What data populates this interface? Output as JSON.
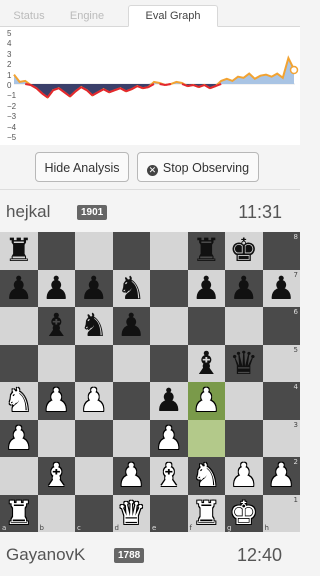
{
  "tabs": [
    {
      "label": "Status"
    },
    {
      "label": "Engine"
    },
    {
      "label": "Eval Graph"
    }
  ],
  "graph": {
    "y_ticks": [
      "5",
      "4",
      "3",
      "2",
      "1",
      "0",
      "−1",
      "−2",
      "−3",
      "−4",
      "−5"
    ],
    "colors": {
      "line": "#f2a332",
      "negative_line": "#e3262f",
      "fill": "#3a3f6a",
      "fill_positive": "#a9c4e4"
    }
  },
  "buttons": {
    "hide_analysis": "Hide Analysis",
    "stop_observing": "Stop Observing"
  },
  "top_player": {
    "name": "hejkal",
    "rating": "1901",
    "clock": "11:31"
  },
  "bottom_player": {
    "name": "GayanovK",
    "rating": "1788",
    "clock": "12:40"
  },
  "board": {
    "files": [
      "a",
      "b",
      "c",
      "d",
      "e",
      "f",
      "g",
      "h"
    ],
    "ranks": [
      "8",
      "7",
      "6",
      "5",
      "4",
      "3",
      "2",
      "1"
    ],
    "rows": [
      [
        "bR",
        "",
        "",
        "",
        "",
        "bR",
        "bK",
        ""
      ],
      [
        "bP",
        "bP",
        "bP",
        "bN",
        "",
        "bP",
        "bP",
        "bP"
      ],
      [
        "",
        "bB",
        "bN",
        "bP",
        "",
        "",
        "",
        ""
      ],
      [
        "",
        "",
        "",
        "",
        "",
        "bB",
        "bQ",
        ""
      ],
      [
        "wN",
        "wP",
        "wP",
        "",
        "bP",
        "wP",
        "",
        ""
      ],
      [
        "wP",
        "",
        "",
        "",
        "wP",
        "",
        "",
        ""
      ],
      [
        "",
        "wB",
        "",
        "wP",
        "wB",
        "wN",
        "wP",
        "wP"
      ],
      [
        "wR",
        "",
        "",
        "wQ",
        "",
        "wR",
        "wK",
        ""
      ]
    ],
    "highlight": [
      "f4",
      "f3"
    ]
  }
}
